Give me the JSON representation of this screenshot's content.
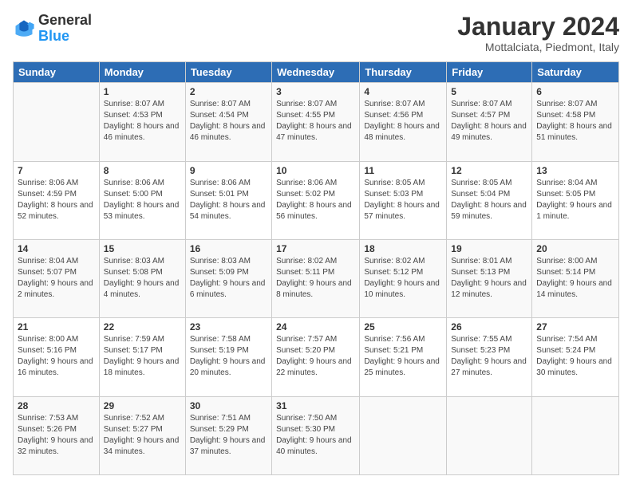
{
  "logo": {
    "general": "General",
    "blue": "Blue"
  },
  "header": {
    "month": "January 2024",
    "location": "Mottalciata, Piedmont, Italy"
  },
  "weekdays": [
    "Sunday",
    "Monday",
    "Tuesday",
    "Wednesday",
    "Thursday",
    "Friday",
    "Saturday"
  ],
  "weeks": [
    [
      {
        "day": "",
        "info": ""
      },
      {
        "day": "1",
        "info": "Sunrise: 8:07 AM\nSunset: 4:53 PM\nDaylight: 8 hours\nand 46 minutes."
      },
      {
        "day": "2",
        "info": "Sunrise: 8:07 AM\nSunset: 4:54 PM\nDaylight: 8 hours\nand 46 minutes."
      },
      {
        "day": "3",
        "info": "Sunrise: 8:07 AM\nSunset: 4:55 PM\nDaylight: 8 hours\nand 47 minutes."
      },
      {
        "day": "4",
        "info": "Sunrise: 8:07 AM\nSunset: 4:56 PM\nDaylight: 8 hours\nand 48 minutes."
      },
      {
        "day": "5",
        "info": "Sunrise: 8:07 AM\nSunset: 4:57 PM\nDaylight: 8 hours\nand 49 minutes."
      },
      {
        "day": "6",
        "info": "Sunrise: 8:07 AM\nSunset: 4:58 PM\nDaylight: 8 hours\nand 51 minutes."
      }
    ],
    [
      {
        "day": "7",
        "info": "Sunrise: 8:06 AM\nSunset: 4:59 PM\nDaylight: 8 hours\nand 52 minutes."
      },
      {
        "day": "8",
        "info": "Sunrise: 8:06 AM\nSunset: 5:00 PM\nDaylight: 8 hours\nand 53 minutes."
      },
      {
        "day": "9",
        "info": "Sunrise: 8:06 AM\nSunset: 5:01 PM\nDaylight: 8 hours\nand 54 minutes."
      },
      {
        "day": "10",
        "info": "Sunrise: 8:06 AM\nSunset: 5:02 PM\nDaylight: 8 hours\nand 56 minutes."
      },
      {
        "day": "11",
        "info": "Sunrise: 8:05 AM\nSunset: 5:03 PM\nDaylight: 8 hours\nand 57 minutes."
      },
      {
        "day": "12",
        "info": "Sunrise: 8:05 AM\nSunset: 5:04 PM\nDaylight: 8 hours\nand 59 minutes."
      },
      {
        "day": "13",
        "info": "Sunrise: 8:04 AM\nSunset: 5:05 PM\nDaylight: 9 hours\nand 1 minute."
      }
    ],
    [
      {
        "day": "14",
        "info": "Sunrise: 8:04 AM\nSunset: 5:07 PM\nDaylight: 9 hours\nand 2 minutes."
      },
      {
        "day": "15",
        "info": "Sunrise: 8:03 AM\nSunset: 5:08 PM\nDaylight: 9 hours\nand 4 minutes."
      },
      {
        "day": "16",
        "info": "Sunrise: 8:03 AM\nSunset: 5:09 PM\nDaylight: 9 hours\nand 6 minutes."
      },
      {
        "day": "17",
        "info": "Sunrise: 8:02 AM\nSunset: 5:11 PM\nDaylight: 9 hours\nand 8 minutes."
      },
      {
        "day": "18",
        "info": "Sunrise: 8:02 AM\nSunset: 5:12 PM\nDaylight: 9 hours\nand 10 minutes."
      },
      {
        "day": "19",
        "info": "Sunrise: 8:01 AM\nSunset: 5:13 PM\nDaylight: 9 hours\nand 12 minutes."
      },
      {
        "day": "20",
        "info": "Sunrise: 8:00 AM\nSunset: 5:14 PM\nDaylight: 9 hours\nand 14 minutes."
      }
    ],
    [
      {
        "day": "21",
        "info": "Sunrise: 8:00 AM\nSunset: 5:16 PM\nDaylight: 9 hours\nand 16 minutes."
      },
      {
        "day": "22",
        "info": "Sunrise: 7:59 AM\nSunset: 5:17 PM\nDaylight: 9 hours\nand 18 minutes."
      },
      {
        "day": "23",
        "info": "Sunrise: 7:58 AM\nSunset: 5:19 PM\nDaylight: 9 hours\nand 20 minutes."
      },
      {
        "day": "24",
        "info": "Sunrise: 7:57 AM\nSunset: 5:20 PM\nDaylight: 9 hours\nand 22 minutes."
      },
      {
        "day": "25",
        "info": "Sunrise: 7:56 AM\nSunset: 5:21 PM\nDaylight: 9 hours\nand 25 minutes."
      },
      {
        "day": "26",
        "info": "Sunrise: 7:55 AM\nSunset: 5:23 PM\nDaylight: 9 hours\nand 27 minutes."
      },
      {
        "day": "27",
        "info": "Sunrise: 7:54 AM\nSunset: 5:24 PM\nDaylight: 9 hours\nand 30 minutes."
      }
    ],
    [
      {
        "day": "28",
        "info": "Sunrise: 7:53 AM\nSunset: 5:26 PM\nDaylight: 9 hours\nand 32 minutes."
      },
      {
        "day": "29",
        "info": "Sunrise: 7:52 AM\nSunset: 5:27 PM\nDaylight: 9 hours\nand 34 minutes."
      },
      {
        "day": "30",
        "info": "Sunrise: 7:51 AM\nSunset: 5:29 PM\nDaylight: 9 hours\nand 37 minutes."
      },
      {
        "day": "31",
        "info": "Sunrise: 7:50 AM\nSunset: 5:30 PM\nDaylight: 9 hours\nand 40 minutes."
      },
      {
        "day": "",
        "info": ""
      },
      {
        "day": "",
        "info": ""
      },
      {
        "day": "",
        "info": ""
      }
    ]
  ]
}
